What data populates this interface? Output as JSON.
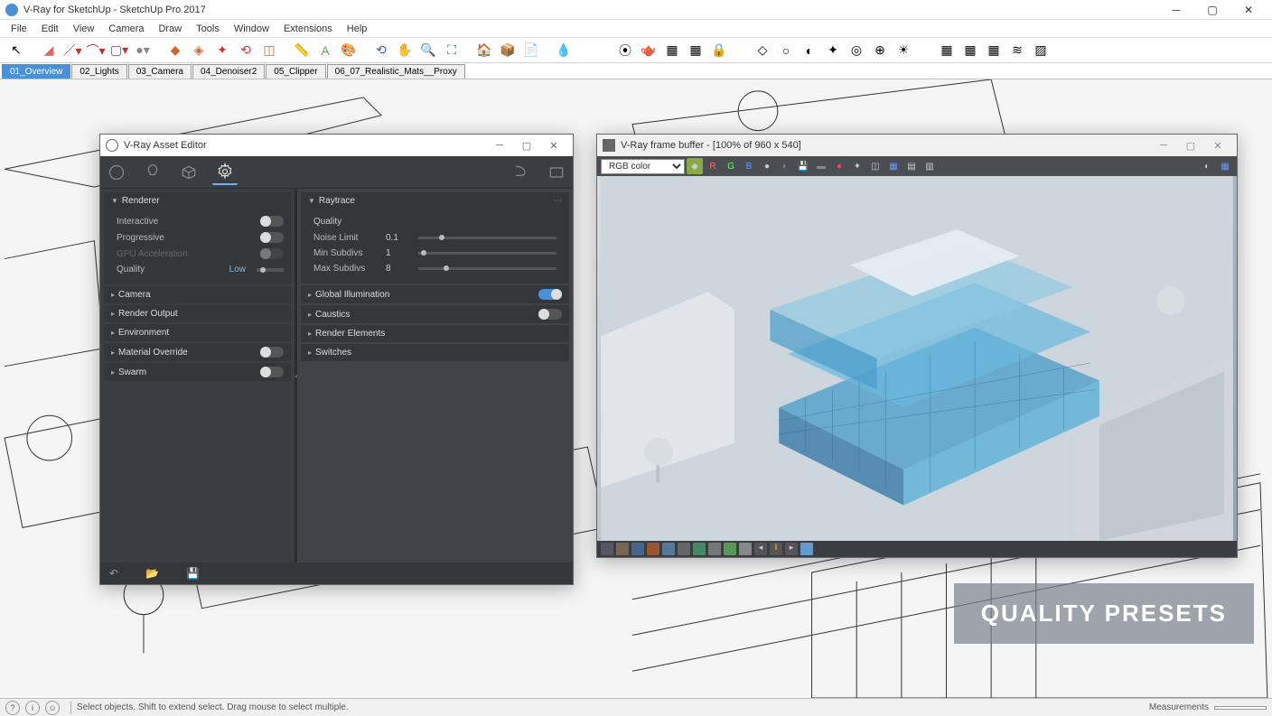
{
  "app": {
    "title": "V-Ray for SketchUp - SketchUp Pro 2017",
    "menus": [
      "File",
      "Edit",
      "View",
      "Camera",
      "Draw",
      "Tools",
      "Window",
      "Extensions",
      "Help"
    ]
  },
  "scene_tabs": [
    {
      "label": "01_Overview",
      "active": true
    },
    {
      "label": "02_Lights",
      "active": false
    },
    {
      "label": "03_Camera",
      "active": false
    },
    {
      "label": "04_Denoiser2",
      "active": false
    },
    {
      "label": "05_Clipper",
      "active": false
    },
    {
      "label": "06_07_Realistic_Mats__Proxy",
      "active": false
    }
  ],
  "asset_editor": {
    "title": "V-Ray Asset Editor",
    "left": {
      "renderer_label": "Renderer",
      "rows": {
        "interactive": {
          "label": "Interactive",
          "on": false
        },
        "progressive": {
          "label": "Progressive",
          "on": false
        },
        "gpu": {
          "label": "GPU Acceleration",
          "on": false
        },
        "quality": {
          "label": "Quality",
          "value": "Low"
        }
      },
      "sections": [
        {
          "label": "Camera"
        },
        {
          "label": "Render Output"
        },
        {
          "label": "Environment"
        },
        {
          "label": "Material Override",
          "toggle": false
        },
        {
          "label": "Swarm",
          "toggle": false
        }
      ]
    },
    "right": {
      "raytrace_label": "Raytrace",
      "quality_label": "Quality",
      "params": [
        {
          "label": "Noise Limit",
          "value": "0.1",
          "pos": 15
        },
        {
          "label": "Min Subdivs",
          "value": "1",
          "pos": 2
        },
        {
          "label": "Max Subdivs",
          "value": "8",
          "pos": 18
        }
      ],
      "sections": [
        {
          "label": "Global Illumination",
          "toggle": true
        },
        {
          "label": "Caustics",
          "toggle": false
        },
        {
          "label": "Render Elements"
        },
        {
          "label": "Switches"
        }
      ]
    }
  },
  "frame_buffer": {
    "title": "V-Ray frame buffer - [100% of 960 x 540]",
    "channel": "RGB color",
    "channel_buttons": [
      "R",
      "G",
      "B"
    ],
    "overlay": "QUALITY PRESETS"
  },
  "statusbar": {
    "hint": "Select objects. Shift to extend select. Drag mouse to select multiple.",
    "measurements_label": "Measurements"
  }
}
